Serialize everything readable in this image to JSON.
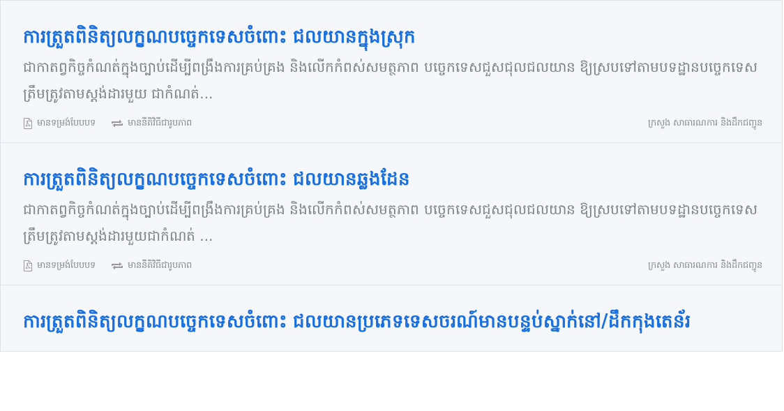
{
  "results": [
    {
      "title": "ការត្រួតពិនិត្យលក្ខណបច្ចេកទេសចំពោះ ជលយានក្នុងស្រុក",
      "description": "ជាកាតព្វកិច្ចកំណត់ក្នុងច្បាប់ដើម្បីពង្រឹងការគ្រប់គ្រង និងលើកកំពស់សមត្ថភាព បច្ចេកទេសជួសជុលជលយាន ឱ្យស្របទៅតាមបទដ្ឋានបច្ចេកទេសត្រឹមត្រូវតាមស្តង់ដារមួយ ជាកំណត់...",
      "form_label": "មានទម្រង់បែបបទ",
      "procedure_label": "មាននីតិវិធីជារូបភាព",
      "ministry": "ក្រសួង សាធារណការ និងដឹកជញ្ជូន"
    },
    {
      "title": "ការត្រួតពិនិត្យលក្ខណបច្ចេកទេសចំពោះ ជលយានឆ្លងដែន",
      "description": "ជាកាតព្វកិច្ចកំណត់ក្នុងច្បាប់ដើម្បីពង្រឹងការគ្រប់គ្រង និងលើកកំពស់សមត្ថភាព បច្ចេកទេសជួសជុលជលយាន ឱ្យស្របទៅតាមបទដ្ឋានបច្ចេកទេសត្រឹមត្រូវតាមស្តង់ដារមួយជាកំណត់ ...",
      "form_label": "មានទម្រង់បែបបទ",
      "procedure_label": "មាននីតិវិធីជារូបភាព",
      "ministry": "ក្រសួង សាធារណការ និងដឹកជញ្ជូន"
    },
    {
      "title": "ការត្រួតពិនិត្យលក្ខណបច្ចេកទេសចំពោះ ជលយានប្រភេទទេសចរណ៍មានបន្ទប់ស្នាក់នៅ/ដឹកកុងតេន័រ"
    }
  ]
}
